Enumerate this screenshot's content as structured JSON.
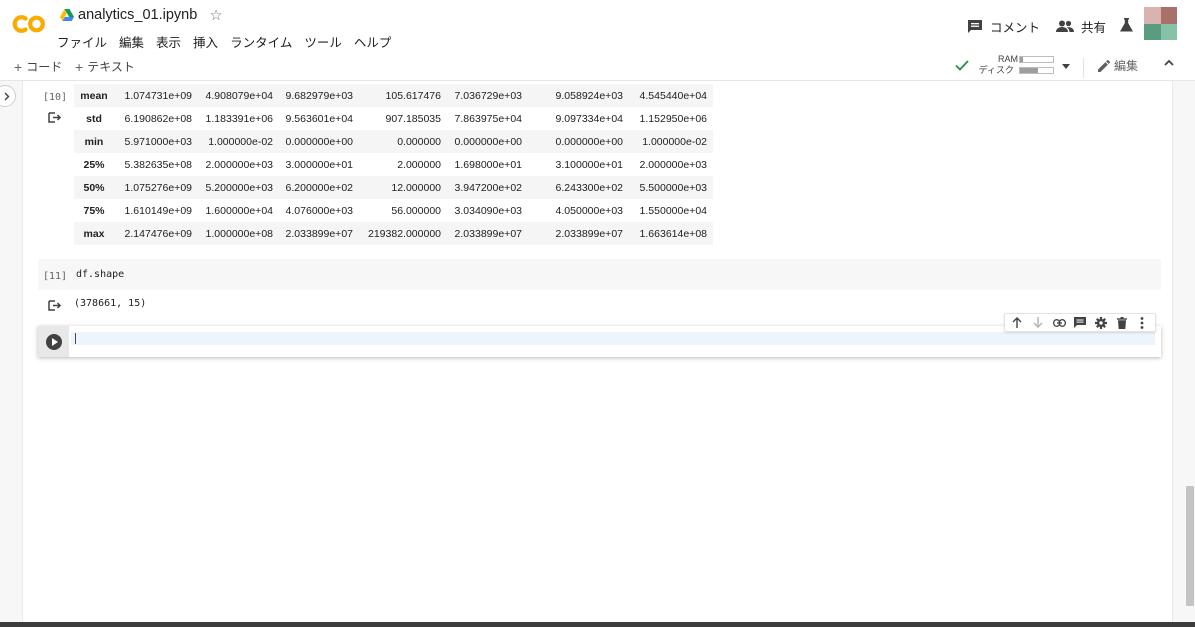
{
  "app": {
    "doc_title": "analytics_01.ipynb"
  },
  "menu": [
    "ファイル",
    "編集",
    "表示",
    "挿入",
    "ランタイム",
    "ツール",
    "ヘルプ"
  ],
  "header": {
    "comment_label": "コメント",
    "share_label": "共有"
  },
  "toolbar": {
    "code_label": "コード",
    "text_label": "テキスト",
    "ram_label": "RAM",
    "disk_label": "ディスク",
    "ram_usage": 0.08,
    "disk_usage": 0.55,
    "edit_label": "編集"
  },
  "cells": [
    {
      "exec_count": "[10]",
      "table": {
        "rows": [
          {
            "label": "mean",
            "values": [
              "1.074731e+09",
              "4.908079e+04",
              "9.682979e+03",
              "105.617476",
              "7.036729e+03",
              "9.058924e+03",
              "4.545440e+04"
            ]
          },
          {
            "label": "std",
            "values": [
              "6.190862e+08",
              "1.183391e+06",
              "9.563601e+04",
              "907.185035",
              "7.863975e+04",
              "9.097334e+04",
              "1.152950e+06"
            ]
          },
          {
            "label": "min",
            "values": [
              "5.971000e+03",
              "1.000000e-02",
              "0.000000e+00",
              "0.000000",
              "0.000000e+00",
              "0.000000e+00",
              "1.000000e-02"
            ]
          },
          {
            "label": "25%",
            "values": [
              "5.382635e+08",
              "2.000000e+03",
              "3.000000e+01",
              "2.000000",
              "1.698000e+01",
              "3.100000e+01",
              "2.000000e+03"
            ]
          },
          {
            "label": "50%",
            "values": [
              "1.075276e+09",
              "5.200000e+03",
              "6.200000e+02",
              "12.000000",
              "3.947200e+02",
              "6.243300e+02",
              "5.500000e+03"
            ]
          },
          {
            "label": "75%",
            "values": [
              "1.610149e+09",
              "1.600000e+04",
              "4.076000e+03",
              "56.000000",
              "3.034090e+03",
              "4.050000e+03",
              "1.550000e+04"
            ]
          },
          {
            "label": "max",
            "values": [
              "2.147476e+09",
              "1.000000e+08",
              "2.033899e+07",
              "219382.000000",
              "2.033899e+07",
              "2.033899e+07",
              "1.663614e+08"
            ]
          }
        ]
      }
    },
    {
      "exec_count": "[11]",
      "code": "df.shape",
      "output": "(378661, 15)"
    },
    {
      "exec_count": "",
      "code": ""
    }
  ],
  "colors": {
    "logo_orange": "#F9AB00",
    "drive_green": "#0F9D58",
    "drive_blue": "#4285F4",
    "drive_yellow": "#FBBC04",
    "check_green": "#1E8E3E",
    "avatar": [
      "#D9B3B0",
      "#A96F6A",
      "#5A9C80",
      "#86C2A8"
    ]
  }
}
